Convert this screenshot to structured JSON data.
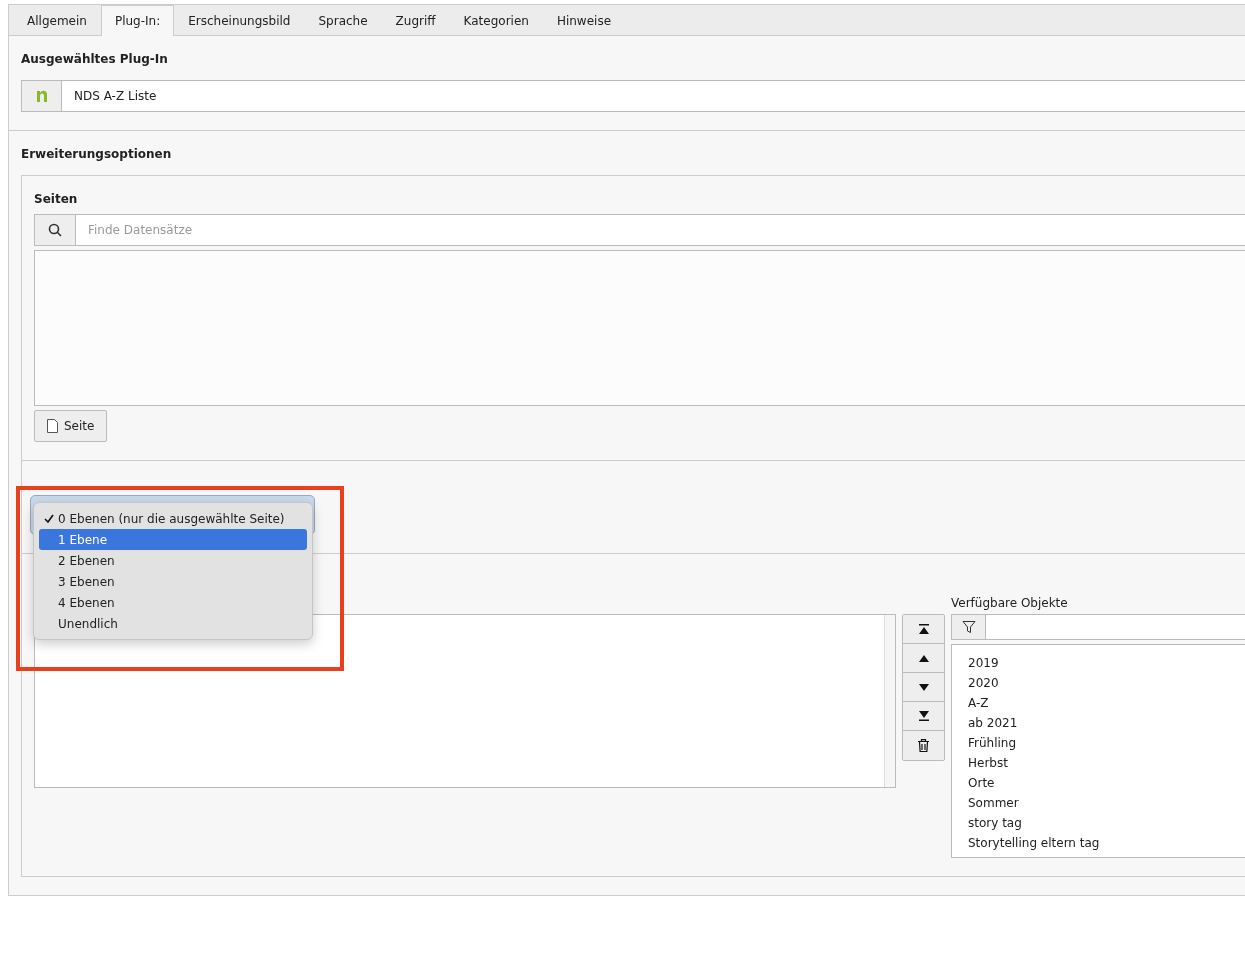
{
  "tabs": [
    {
      "label": "Allgemein",
      "selected": false
    },
    {
      "label": "Plug-In:",
      "selected": true
    },
    {
      "label": "Erscheinungsbild",
      "selected": false
    },
    {
      "label": "Sprache",
      "selected": false
    },
    {
      "label": "Zugriff",
      "selected": false
    },
    {
      "label": "Kategorien",
      "selected": false
    },
    {
      "label": "Hinweise",
      "selected": false
    }
  ],
  "plugin_section": {
    "title": "Ausgewähltes Plug-In",
    "value": "NDS A-Z Liste"
  },
  "options_section": {
    "title": "Erweiterungsoptionen",
    "pages": {
      "label": "Seiten",
      "search_placeholder": "Finde Datensätze",
      "add_button": "Seite"
    },
    "depth_dropdown": {
      "options": [
        {
          "label": "0 Ebenen (nur die ausgewählte Seite)",
          "checked": true,
          "selected": false
        },
        {
          "label": "1 Ebene",
          "checked": false,
          "selected": true
        },
        {
          "label": "2 Ebenen",
          "checked": false,
          "selected": false
        },
        {
          "label": "3 Ebenen",
          "checked": false,
          "selected": false
        },
        {
          "label": "4 Ebenen",
          "checked": false,
          "selected": false
        },
        {
          "label": "Unendlich",
          "checked": false,
          "selected": false
        }
      ]
    },
    "available": {
      "label": "Verfügbare Objekte",
      "items": [
        "2019",
        "2020",
        "A-Z",
        "ab 2021",
        "Frühling",
        "Herbst",
        "Orte",
        "Sommer",
        "story tag",
        "Storytelling eltern tag"
      ]
    }
  }
}
